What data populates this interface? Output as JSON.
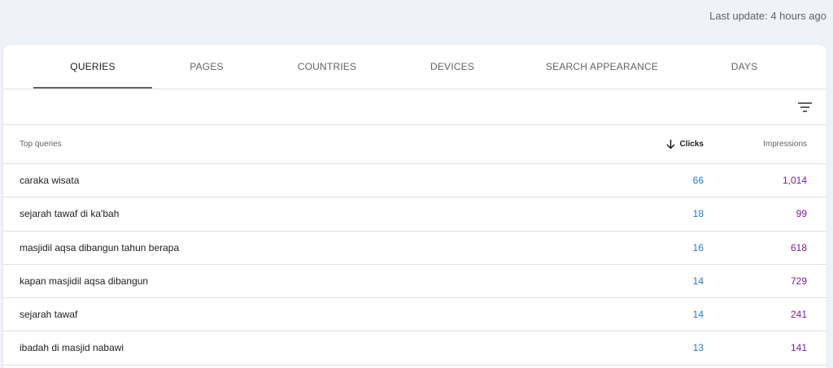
{
  "header": {
    "last_update": "Last update: 4 hours ago"
  },
  "tabs": [
    {
      "label": "QUERIES",
      "active": true
    },
    {
      "label": "PAGES",
      "active": false
    },
    {
      "label": "COUNTRIES",
      "active": false
    },
    {
      "label": "DEVICES",
      "active": false
    },
    {
      "label": "SEARCH APPEARANCE",
      "active": false
    },
    {
      "label": "DAYS",
      "active": false
    }
  ],
  "toolbar": {
    "filter_icon": "filter-list-icon"
  },
  "table": {
    "columns": {
      "query": "Top queries",
      "clicks": "Clicks",
      "impressions": "Impressions",
      "sort_icon": "arrow-down-icon"
    },
    "rows": [
      {
        "query": "caraka wisata",
        "clicks": "66",
        "impressions": "1,014"
      },
      {
        "query": "sejarah tawaf di ka'bah",
        "clicks": "18",
        "impressions": "99"
      },
      {
        "query": "masjidil aqsa dibangun tahun berapa",
        "clicks": "16",
        "impressions": "618"
      },
      {
        "query": "kapan masjidil aqsa dibangun",
        "clicks": "14",
        "impressions": "729"
      },
      {
        "query": "sejarah tawaf",
        "clicks": "14",
        "impressions": "241"
      },
      {
        "query": "ibadah di masjid nabawi",
        "clicks": "13",
        "impressions": "141"
      }
    ]
  },
  "colors": {
    "clicks": "#2b7bb9",
    "impressions": "#7b1fa2",
    "background": "#eff2f6"
  }
}
